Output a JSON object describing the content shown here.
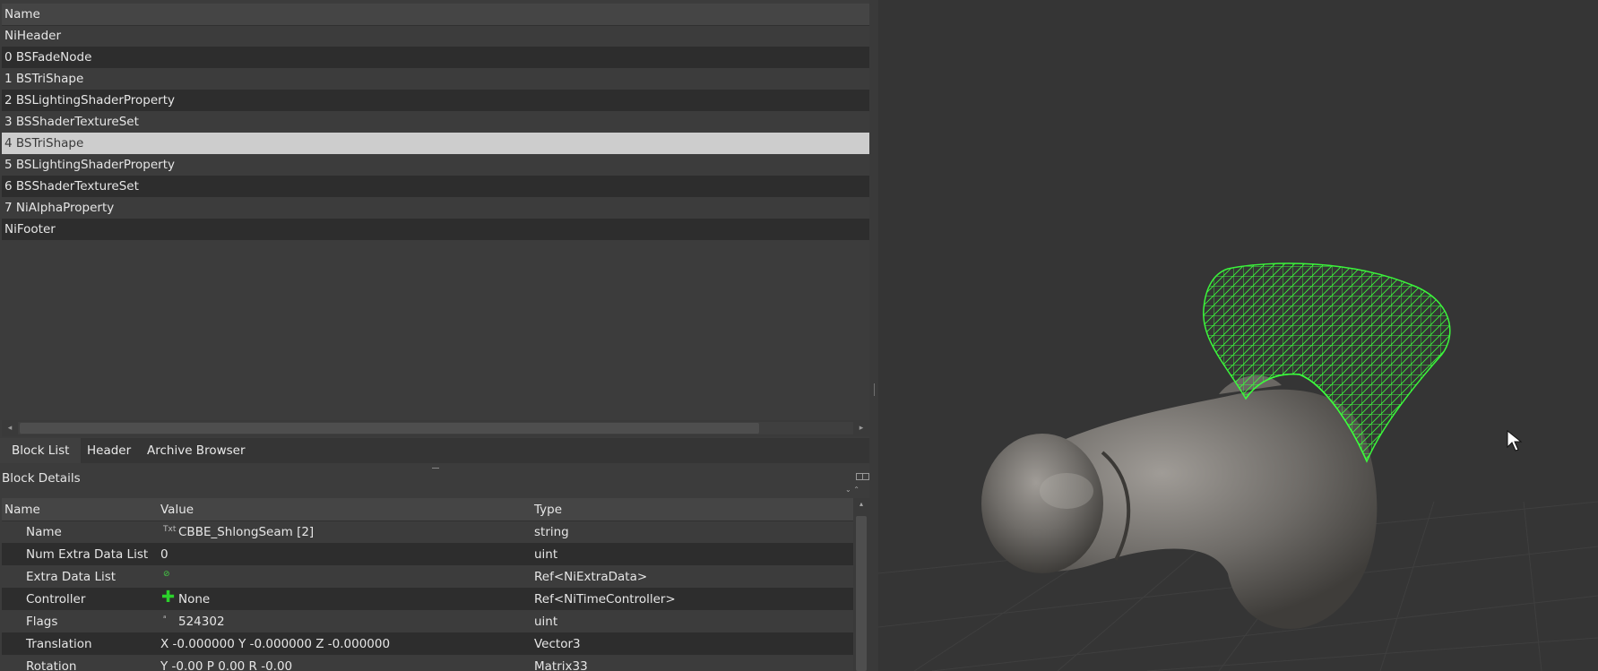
{
  "block_list": {
    "column_header": "Name",
    "items": [
      {
        "label": "NiHeader"
      },
      {
        "label": "0 BSFadeNode"
      },
      {
        "label": "1 BSTriShape"
      },
      {
        "label": "2 BSLightingShaderProperty"
      },
      {
        "label": "3 BSShaderTextureSet"
      },
      {
        "label": "4 BSTriShape",
        "selected": true
      },
      {
        "label": "5 BSLightingShaderProperty"
      },
      {
        "label": "6 BSShaderTextureSet"
      },
      {
        "label": "7 NiAlphaProperty"
      },
      {
        "label": "NiFooter"
      }
    ]
  },
  "tabs": [
    {
      "label": "Block List",
      "active": true
    },
    {
      "label": "Header"
    },
    {
      "label": "Archive Browser"
    }
  ],
  "block_details": {
    "title": "Block Details",
    "columns": {
      "name": "Name",
      "value": "Value",
      "type": "Type"
    },
    "rows": [
      {
        "name": "Name",
        "value": "CBBE_ShlongSeam [2]",
        "type": "string",
        "icon": "text-icon"
      },
      {
        "name": "Num Extra Data List",
        "value": "0",
        "type": "uint"
      },
      {
        "name": "Extra Data List",
        "value": "",
        "type": "Ref<NiExtraData>",
        "icon": "link-icon"
      },
      {
        "name": "Controller",
        "value": "None",
        "type": "Ref<NiTimeController>",
        "icon": "plus-icon"
      },
      {
        "name": "Flags",
        "value": "524302",
        "type": "uint",
        "icon": "flag-icon"
      },
      {
        "name": "Translation",
        "value": "X -0.000000 Y -0.000000 Z -0.000000",
        "type": "Vector3"
      },
      {
        "name": "Rotation",
        "value": "Y -0.00 P 0.00 R -0.00",
        "type": "Matrix33"
      }
    ]
  },
  "viewport": {
    "background": "#353535",
    "wireframe_color": "#3cff3c",
    "mesh_color": "#6f6c68"
  },
  "colors": {
    "panel_bg": "#3c3c3c",
    "row_alt": "#2d2d2d",
    "selection": "#cdcdcd"
  }
}
